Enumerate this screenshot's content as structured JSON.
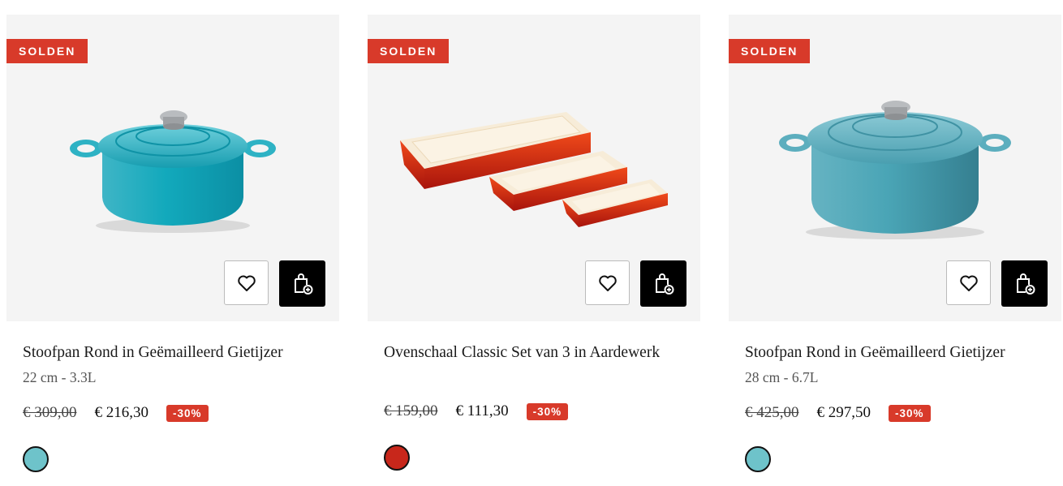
{
  "products": [
    {
      "badge": "SOLDEN",
      "title": "Stoofpan Rond in Geëmailleerd Gietijzer",
      "subtitle": "22 cm - 3.3L",
      "old_price": "€ 309,00",
      "new_price": "€ 216,30",
      "discount": "-30%",
      "swatch_color": "#6ec3ca",
      "image_icon": "cocotte-icon"
    },
    {
      "badge": "SOLDEN",
      "title": "Ovenschaal Classic Set van 3 in Aardewerk",
      "subtitle": "",
      "old_price": "€ 159,00",
      "new_price": "€ 111,30",
      "discount": "-30%",
      "swatch_color": "#c8271b",
      "image_icon": "baking-dish-icon"
    },
    {
      "badge": "SOLDEN",
      "title": "Stoofpan Rond in Geëmailleerd Gietijzer",
      "subtitle": "28 cm - 6.7L",
      "old_price": "€ 425,00",
      "new_price": "€ 297,50",
      "discount": "-30%",
      "swatch_color": "#6ec3ca",
      "image_icon": "cocotte-icon"
    }
  ],
  "colors": {
    "badge_red": "#d83a2a",
    "card_bg": "#f4f4f4",
    "cart_button_bg": "#000000"
  }
}
